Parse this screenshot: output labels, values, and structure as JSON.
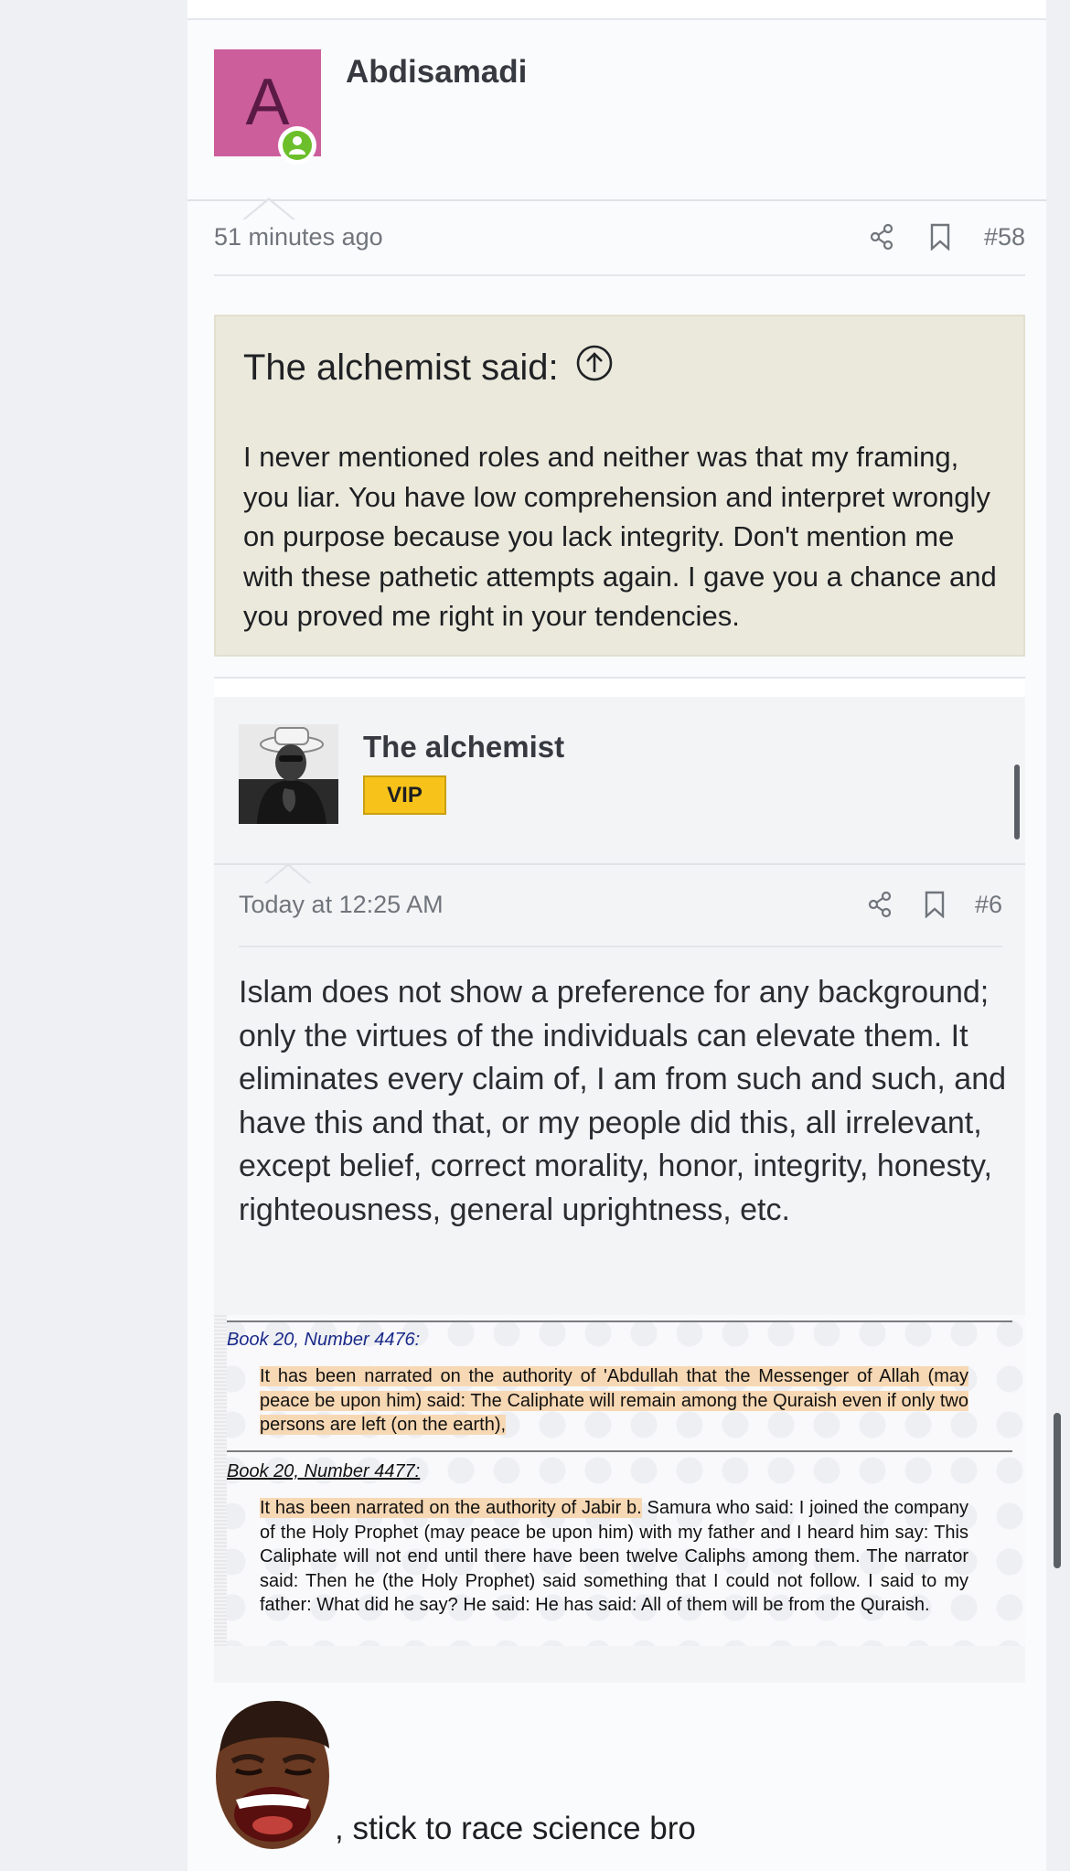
{
  "post": {
    "author": "Abdisamadi",
    "avatar_letter": "A",
    "avatar_color": "#cc5e9c",
    "online_icon": "user-online-icon",
    "time": "51 minutes ago",
    "number": "#58",
    "icons": [
      "share-icon",
      "bookmark-icon"
    ]
  },
  "quote": {
    "header": "The alchemist said:",
    "header_icon": "arrow-up-circle-icon",
    "body": "I never mentioned roles and neither was that my framing, you liar. You have low comprehension and interpret wrongly on purpose because you lack integrity. Don't mention me with these pathetic attempts again. I gave you a chance and you proved me right in your tendencies."
  },
  "embedded_post": {
    "author": "The alchemist",
    "badge": "VIP",
    "badge_color": "#f7c31b",
    "time": "Today at 12:25 AM",
    "number": "#6",
    "body": "Islam does not show a preference for any background; only the virtues of the individuals can elevate them. It eliminates every claim of, I am from such and such, and have this and that, or my people did this, all irrelevant, except belief, correct morality, honor, integrity, honesty, righteousness, general uprightness, etc."
  },
  "hadith": {
    "title1": "Book 20, Number 4476:",
    "text1": "It has been narrated on the authority of 'Abdullah that the Messenger of Allah (may peace be upon him) said: The Caliphate will remain among the Quraish even if only two persons are left (on the earth),",
    "title2": "Book 20, Number 4477:",
    "text2_highlight": "It has been narrated on the authority of Jabir b.",
    "text2_rest": " Samura who said: I joined the company of the Holy Prophet (may peace be upon him) with my father and I heard him say: This Caliphate will not end until there have been twelve Caliphs among them. The narrator said: Then he (the Holy Prophet) said something that I could not follow. I said to my father: What did he say? He said: He has said: All of them will be from the Quraish."
  },
  "reply_text": ", stick to race science bro",
  "reply_emoji_icon": "laughing-face-icon"
}
